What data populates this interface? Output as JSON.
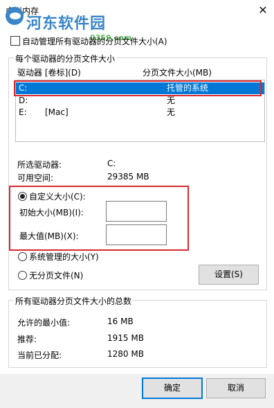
{
  "window": {
    "title": "虚拟内存",
    "close_label": "✕"
  },
  "watermark": {
    "text": "河东软件园",
    "url": "0359.com"
  },
  "auto_manage": {
    "label": "自动管理所有驱动器的分页文件大小(A)",
    "checked": false
  },
  "drives_group": {
    "legend": "每个驱动器的分页文件大小",
    "col_drive": "驱动器 [卷标](D)",
    "col_size": "分页文件大小(MB)",
    "rows": [
      {
        "drive": "C:",
        "label": "",
        "size": "托管的系统",
        "selected": true
      },
      {
        "drive": "D:",
        "label": "",
        "size": "无",
        "selected": false
      },
      {
        "drive": "E:",
        "label": "[Mac]",
        "size": "无",
        "selected": false
      }
    ],
    "selected_drive_label": "所选驱动器:",
    "selected_drive_value": "C:",
    "free_space_label": "可用空间:",
    "free_space_value": "29385 MB",
    "custom_size_label": "自定义大小(C):",
    "initial_size_label": "初始大小(MB)(I):",
    "initial_size_value": "",
    "max_size_label": "最大值(MB)(X):",
    "max_size_value": "",
    "system_managed_label": "系统管理的大小(Y)",
    "no_paging_label": "无分页文件(N)",
    "set_button": "设置(S)"
  },
  "totals_group": {
    "legend": "所有驱动器分页文件大小的总数",
    "min_label": "允许的最小值:",
    "min_value": "16 MB",
    "recommended_label": "推荐:",
    "recommended_value": "1915 MB",
    "current_label": "当前已分配:",
    "current_value": "1280 MB"
  },
  "buttons": {
    "ok": "确定",
    "cancel": "取消"
  },
  "colors": {
    "selection": "#0078d7",
    "highlight_box": "#d9282f",
    "watermark": "#3a86c8"
  }
}
